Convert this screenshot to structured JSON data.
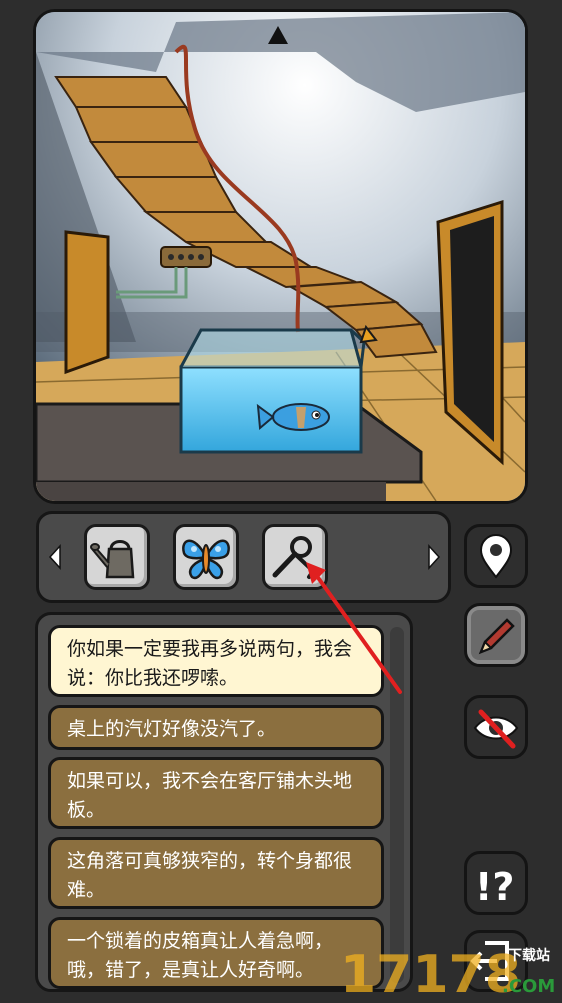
{
  "scene": {
    "description_icons": [
      "up-arrow-icon"
    ]
  },
  "inventory": {
    "items": [
      {
        "name": "watering-can-icon"
      },
      {
        "name": "butterfly-icon"
      },
      {
        "name": "wrench-key-icon"
      }
    ],
    "prev_icon": "left-arrow-icon",
    "next_icon": "right-arrow-icon"
  },
  "sidebar": {
    "map_icon": "map-pin-icon",
    "notes_icon": "pencil-icon",
    "hide_icon": "eye-crossed-icon",
    "hint_icon": "hint-icon",
    "exit_icon": "exit-icon"
  },
  "dialog": {
    "lines": [
      "你如果一定要我再多说两句，我会说：你比我还啰嗦。",
      "桌上的汽灯好像没汽了。",
      "如果可以，我不会在客厅铺木头地板。",
      "这角落可真够狭窄的，转个身都很难。",
      "一个锁着的皮箱真让人着急啊，哦，错了，是真让人好奇啊。"
    ]
  },
  "watermark": {
    "digits": "17178",
    "site_top": "下载站",
    "site_bottom": ".COM"
  },
  "colors": {
    "accent_arrow": "#e02020",
    "bubble_active": "#fff6d2",
    "bubble": "#8b6f3f"
  }
}
